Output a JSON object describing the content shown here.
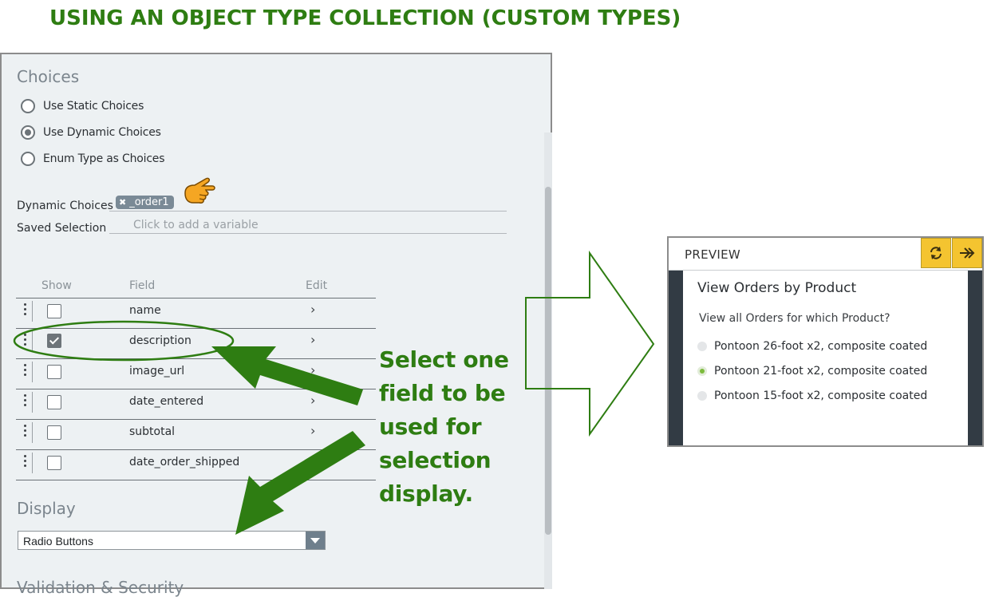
{
  "title": "USING AN OBJECT TYPE COLLECTION (CUSTOM TYPES)",
  "choices": {
    "heading": "Choices",
    "options": [
      {
        "label": "Use Static Choices",
        "selected": false
      },
      {
        "label": "Use Dynamic Choices",
        "selected": true
      },
      {
        "label": "Enum Type as Choices",
        "selected": false
      }
    ],
    "dynamic_choices_label": "Dynamic Choices",
    "dynamic_choices_chip": "_order1",
    "chip_remove_glyph": "✖",
    "saved_selection_label": "Saved Selection",
    "saved_selection_placeholder": "Click to add a variable"
  },
  "fields_table": {
    "headers": {
      "show": "Show",
      "field": "Field",
      "edit": "Edit"
    },
    "rows": [
      {
        "field": "name",
        "show": false
      },
      {
        "field": "description",
        "show": true
      },
      {
        "field": "image_url",
        "show": false
      },
      {
        "field": "date_entered",
        "show": false
      },
      {
        "field": "subtotal",
        "show": false
      },
      {
        "field": "date_order_shipped",
        "show": false
      }
    ],
    "edit_glyph": "›"
  },
  "display": {
    "heading": "Display",
    "selected": "Radio Buttons"
  },
  "validation_heading": "Validation & Security",
  "annotation": {
    "lines": [
      "Select one",
      "field to be",
      "used for",
      "selection",
      "display."
    ],
    "color": "#2e7d12"
  },
  "preview": {
    "header": "PREVIEW",
    "body_title": "View Orders by Product",
    "question": "View all Orders for which Product?",
    "options": [
      {
        "label": "Pontoon 26-foot x2, composite coated",
        "selected": false
      },
      {
        "label": "Pontoon 21-foot x2, composite coated",
        "selected": true
      },
      {
        "label": "Pontoon 15-foot x2, composite coated",
        "selected": false
      }
    ],
    "accent_color": "#f4c430",
    "side_color": "#323b44"
  },
  "icons": {
    "pointing_hand": "pointing-hand-icon",
    "refresh": "refresh-icon",
    "forward": "double-arrow-right-icon",
    "drag": "drag-handle-icon",
    "dropdown": "chevron-down-icon"
  }
}
